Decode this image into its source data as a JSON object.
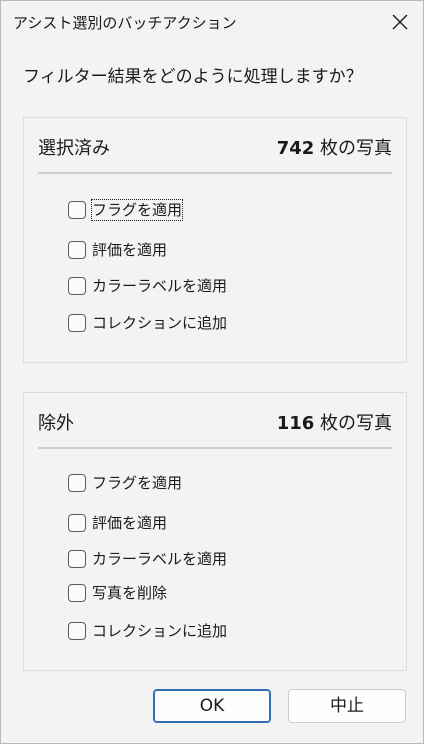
{
  "window": {
    "title": "アシスト選別のバッチアクション",
    "close_icon": "close-icon"
  },
  "question": "フィルター結果をどのように処理しますか？",
  "selected_group": {
    "label": "選択済み",
    "count": "742",
    "count_suffix": " 枚の写真",
    "options": [
      {
        "label": "フラグを適用",
        "checked": false,
        "focused": true
      },
      {
        "label": "評価を適用",
        "checked": false
      },
      {
        "label": "カラーラベルを適用",
        "checked": false
      },
      {
        "label": "コレクションに追加",
        "checked": false
      }
    ]
  },
  "excluded_group": {
    "label": "除外",
    "count": "116",
    "count_suffix": " 枚の写真",
    "options": [
      {
        "label": "フラグを適用",
        "checked": false
      },
      {
        "label": "評価を適用",
        "checked": false
      },
      {
        "label": "カラーラベルを適用",
        "checked": false
      },
      {
        "label": "写真を削除",
        "checked": false
      },
      {
        "label": "コレクションに追加",
        "checked": false
      }
    ]
  },
  "buttons": {
    "ok_label": "OK",
    "cancel_label": "中止"
  },
  "colors": {
    "accent": "#2f6fb6",
    "background": "#f3f3f3"
  }
}
